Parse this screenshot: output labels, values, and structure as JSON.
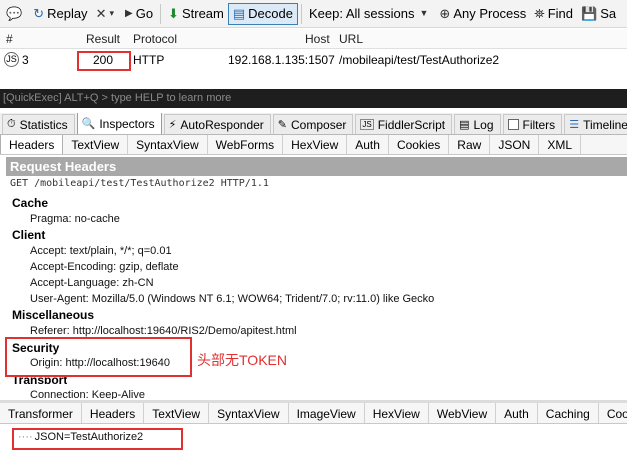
{
  "toolbar": {
    "items": [
      {
        "label": "",
        "icon": "chat-bubble-icon"
      },
      {
        "label": "Replay",
        "icon": "replay-icon"
      },
      {
        "label": "",
        "icon": "remove-icon"
      },
      {
        "label": "Go",
        "icon": "play-icon"
      },
      {
        "label": "Stream",
        "icon": "stream-icon"
      },
      {
        "label": "Decode",
        "icon": "decode-icon"
      },
      {
        "label": "Keep: All sessions",
        "icon": "dropdown-icon"
      },
      {
        "label": "Any Process",
        "icon": "crosshair-icon"
      },
      {
        "label": "Find",
        "icon": "binoculars-icon"
      },
      {
        "label": "Sa",
        "icon": "save-icon"
      }
    ]
  },
  "grid": {
    "headers": {
      "num": "#",
      "result": "Result",
      "protocol": "Protocol",
      "host": "Host",
      "url": "URL"
    },
    "row": {
      "num": "3",
      "result": "200",
      "protocol": "HTTP",
      "host": "192.168.1.135:1507",
      "url": "/mobileapi/test/TestAuthorize2"
    }
  },
  "quickexec": {
    "placeholder": "[QuickExec] ALT+Q > type HELP to learn more"
  },
  "main_tabs": [
    {
      "label": "Statistics",
      "icon": "stopwatch-icon"
    },
    {
      "label": "Inspectors",
      "icon": "inspect-icon"
    },
    {
      "label": "AutoResponder",
      "icon": "lightning-icon"
    },
    {
      "label": "Composer",
      "icon": "pencil-icon"
    },
    {
      "label": "FiddlerScript",
      "icon": "js-icon"
    },
    {
      "label": "Log",
      "icon": "log-icon"
    },
    {
      "label": "Filters",
      "icon": "checkbox-icon"
    },
    {
      "label": "Timeline",
      "icon": "timeline-icon"
    }
  ],
  "request_tabs": [
    "Headers",
    "TextView",
    "SyntaxView",
    "WebForms",
    "HexView",
    "Auth",
    "Cookies",
    "Raw",
    "JSON",
    "XML"
  ],
  "request": {
    "title": "Request Headers",
    "request_line": "GET /mobileapi/test/TestAuthorize2 HTTP/1.1",
    "groups": {
      "cache": {
        "name": "Cache",
        "entries": [
          "Pragma: no-cache"
        ]
      },
      "client": {
        "name": "Client",
        "entries": [
          "Accept: text/plain, */*; q=0.01",
          "Accept-Encoding: gzip, deflate",
          "Accept-Language: zh-CN",
          "User-Agent: Mozilla/5.0 (Windows NT 6.1; WOW64; Trident/7.0; rv:11.0) like Gecko"
        ]
      },
      "misc": {
        "name": "Miscellaneous",
        "entries": [
          "Referer: http://localhost:19640/RIS2/Demo/apitest.html"
        ]
      },
      "security": {
        "name": "Security",
        "entries": [
          "Origin: http://localhost:19640"
        ]
      },
      "transport": {
        "name": "Transport",
        "entries": [
          "Connection: Keep-Alive"
        ]
      }
    }
  },
  "annotation": "头部无TOKEN",
  "response_tabs": [
    "Transformer",
    "Headers",
    "TextView",
    "SyntaxView",
    "ImageView",
    "HexView",
    "WebView",
    "Auth",
    "Caching",
    "Coo"
  ],
  "response": {
    "tree_item": "JSON=TestAuthorize2"
  },
  "colors": {
    "highlight": "#e03030",
    "title_bar": "#a8a8a8",
    "quickexec_bg": "#1e1e1e"
  }
}
